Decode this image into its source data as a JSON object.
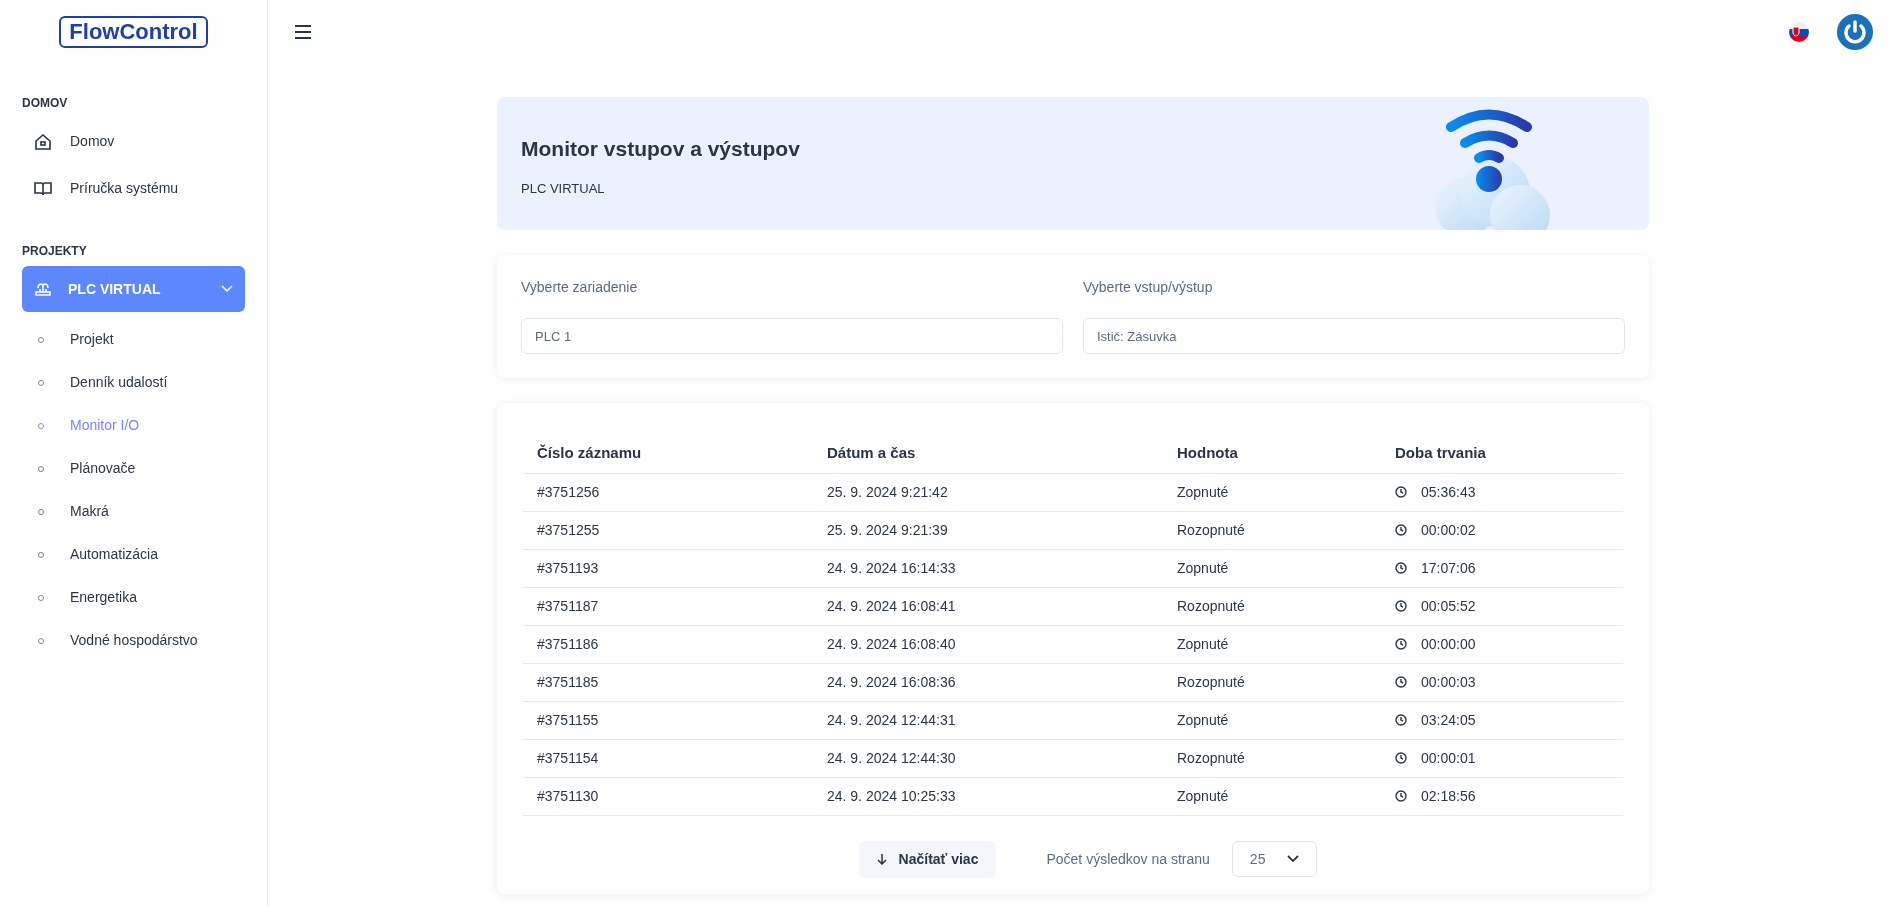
{
  "logo": "FlowControl",
  "sidebar": {
    "sections": [
      {
        "title": "DOMOV",
        "items": [
          {
            "label": "Domov",
            "kind": "home"
          },
          {
            "label": "Príručka systému",
            "kind": "book"
          }
        ]
      },
      {
        "title": "PROJEKTY",
        "project": {
          "label": "PLC VIRTUAL",
          "expanded": true,
          "selected": true
        },
        "items": [
          {
            "label": "Projekt",
            "selected": false
          },
          {
            "label": "Denník udalostí",
            "selected": false
          },
          {
            "label": "Monitor I/O",
            "selected": true
          },
          {
            "label": "Plánovače",
            "selected": false
          },
          {
            "label": "Makrá",
            "selected": false
          },
          {
            "label": "Automatizácia",
            "selected": false
          },
          {
            "label": "Energetika",
            "selected": false
          },
          {
            "label": "Vodné hospodárstvo",
            "selected": false
          }
        ]
      }
    ]
  },
  "banner": {
    "title": "Monitor vstupov a výstupov",
    "subtitle": "PLC VIRTUAL"
  },
  "filters": [
    {
      "label": "Vyberte zariadenie",
      "value": "PLC 1"
    },
    {
      "label": "Vyberte vstup/výstup",
      "value": "Istič: Zásuvka"
    }
  ],
  "table": {
    "columns": [
      "Číslo záznamu",
      "Dátum a čas",
      "Hodnota",
      "Doba trvania"
    ],
    "rows": [
      [
        "#3751256",
        "25. 9. 2024 9:21:42",
        "Zopnuté",
        "05:36:43"
      ],
      [
        "#3751255",
        "25. 9. 2024 9:21:39",
        "Rozopnuté",
        "00:00:02"
      ],
      [
        "#3751193",
        "24. 9. 2024 16:14:33",
        "Zopnuté",
        "17:07:06"
      ],
      [
        "#3751187",
        "24. 9. 2024 16:08:41",
        "Rozopnuté",
        "00:05:52"
      ],
      [
        "#3751186",
        "24. 9. 2024 16:08:40",
        "Zopnuté",
        "00:00:00"
      ],
      [
        "#3751185",
        "24. 9. 2024 16:08:36",
        "Rozopnuté",
        "00:00:03"
      ],
      [
        "#3751155",
        "24. 9. 2024 12:44:31",
        "Zopnuté",
        "03:24:05"
      ],
      [
        "#3751154",
        "24. 9. 2024 12:44:30",
        "Rozopnuté",
        "00:00:01"
      ],
      [
        "#3751130",
        "24. 9. 2024 10:25:33",
        "Zopnuté",
        "02:18:56"
      ]
    ]
  },
  "footer": {
    "load_more": "Načítať viac",
    "per_page_label": "Počet výsledkov na stranu",
    "per_page": "25"
  }
}
